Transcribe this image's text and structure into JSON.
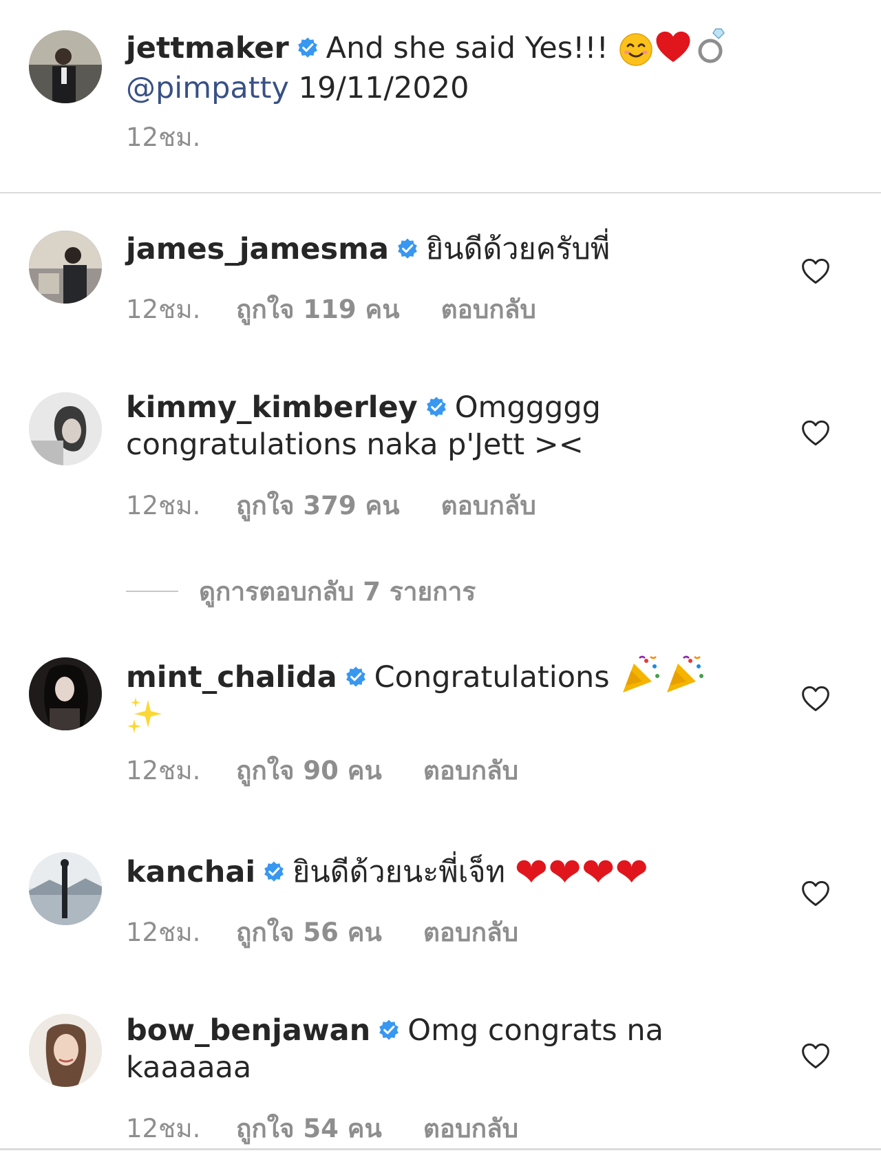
{
  "post": {
    "username": "jettmaker",
    "caption": "And she said Yes!!!",
    "caption_emojis": [
      "😊",
      "❤",
      "💍"
    ],
    "mention": "@pimpatty",
    "date": "19/11/2020",
    "time": "12ชม."
  },
  "comments": [
    {
      "username": "james_jamesma",
      "text": "ยินดีด้วยครับพี่",
      "emojis": "",
      "time": "12ชม.",
      "likes": "ถูกใจ 119 คน",
      "reply": "ตอบกลับ"
    },
    {
      "username": "kimmy_kimberley",
      "text": "Omggggg congratulations naka p'Jett ><",
      "emojis": "",
      "time": "12ชม.",
      "likes": "ถูกใจ 379 คน",
      "reply": "ตอบกลับ"
    },
    {
      "username": "mint_chalida",
      "text": "Congratulations",
      "emojis": "🎉🎉 ✨",
      "time": "12ชม.",
      "likes": "ถูกใจ 90 คน",
      "reply": "ตอบกลับ"
    },
    {
      "username": "kanchai",
      "text": "ยินดีด้วยนะพี่เจ็ท",
      "emojis": "❤❤❤❤",
      "time": "12ชม.",
      "likes": "ถูกใจ 56 คน",
      "reply": "ตอบกลับ"
    },
    {
      "username": "bow_benjawan",
      "text": "Omg congrats na kaaaaaa",
      "emojis": "",
      "time": "12ชม.",
      "likes": "ถูกใจ 54 คน",
      "reply": "ตอบกลับ"
    }
  ],
  "view_replies": "ดูการตอบกลับ 7 รายการ",
  "icons": {
    "verified_badge": "verified-badge-icon",
    "like": "heart-outline-icon"
  },
  "colors": {
    "verified": "#3897f0",
    "mention": "#385185",
    "meta": "#8e8e8e",
    "text": "#262626"
  }
}
